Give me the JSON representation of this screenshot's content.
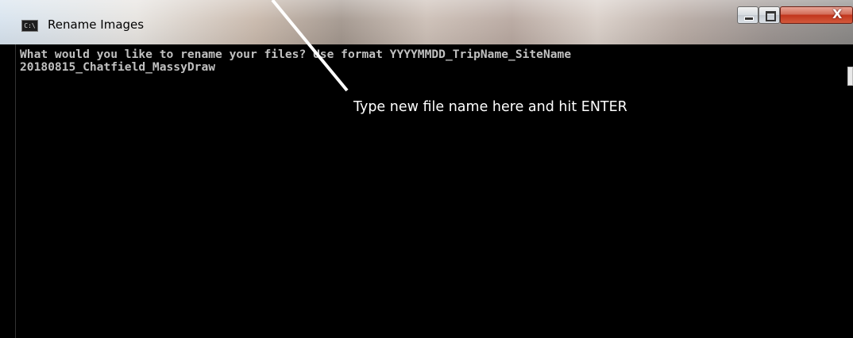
{
  "window": {
    "title": "Rename Images",
    "icon": "console-icon",
    "icon_text": "C:\\",
    "buttons": {
      "minimize": "minimize-icon",
      "maximize": "maximize-icon",
      "close": "close-icon"
    },
    "close_glyph": "X"
  },
  "console": {
    "lines": [
      "What would you like to rename your files? Use format YYYYMMDD_TripName_SiteName",
      "20180815_Chatfield_MassyDraw"
    ],
    "background": "#000000",
    "text_color": "#c0c0c0"
  },
  "annotation": {
    "text": "Type new file name here and hit ENTER",
    "color": "#ffffff"
  }
}
